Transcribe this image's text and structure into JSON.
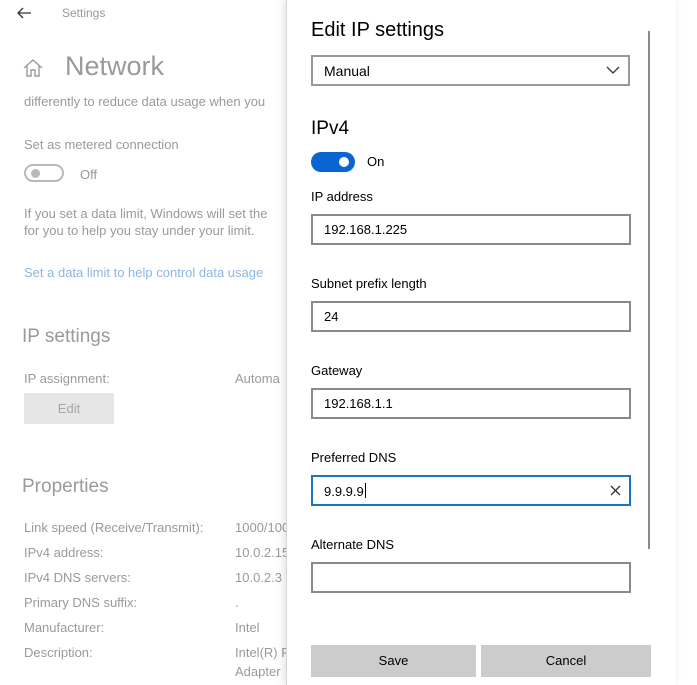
{
  "window": {
    "app_title": "Settings"
  },
  "background": {
    "page_title": "Network",
    "clipped_text": "differently to reduce data usage when you",
    "metered_label": "Set as metered connection",
    "metered_state": "Off",
    "limit_text_line1": "If you set a data limit, Windows will set the",
    "limit_text_line2": "for you to help you stay under your limit.",
    "limit_link": "Set a data limit to help control data usage",
    "ip_settings_title": "IP settings",
    "ip_assignment_label": "IP assignment:",
    "ip_assignment_value": "Automa",
    "edit_label": "Edit",
    "properties_title": "Properties",
    "properties": [
      {
        "label": "Link speed (Receive/Transmit):",
        "value": "1000/100"
      },
      {
        "label": "IPv4 address:",
        "value": "10.0.2.15"
      },
      {
        "label": "IPv4 DNS servers:",
        "value": "10.0.2.3"
      },
      {
        "label": "Primary DNS suffix:",
        "value": "."
      },
      {
        "label": "Manufacturer:",
        "value": "Intel"
      },
      {
        "label": "Description:",
        "value": "Intel(R) P",
        "value_line2": "Adapter"
      }
    ]
  },
  "dialog": {
    "title": "Edit IP settings",
    "mode_select": "Manual",
    "ipv4_title": "IPv4",
    "ipv4_toggle_state": "On",
    "fields": {
      "ip_address": {
        "label": "IP address",
        "value": "192.168.1.225"
      },
      "subnet": {
        "label": "Subnet prefix length",
        "value": "24"
      },
      "gateway": {
        "label": "Gateway",
        "value": "192.168.1.1"
      },
      "preferred_dns": {
        "label": "Preferred DNS",
        "value": "9.9.9.9"
      },
      "alternate_dns": {
        "label": "Alternate DNS",
        "value": ""
      }
    },
    "save_label": "Save",
    "cancel_label": "Cancel"
  },
  "colors": {
    "accent": "#0a64d2",
    "focus_border": "#1a73c8",
    "link": "#8db6e0"
  },
  "icons": [
    "back-arrow-icon",
    "home-icon",
    "chevron-down-icon",
    "clear-icon"
  ]
}
